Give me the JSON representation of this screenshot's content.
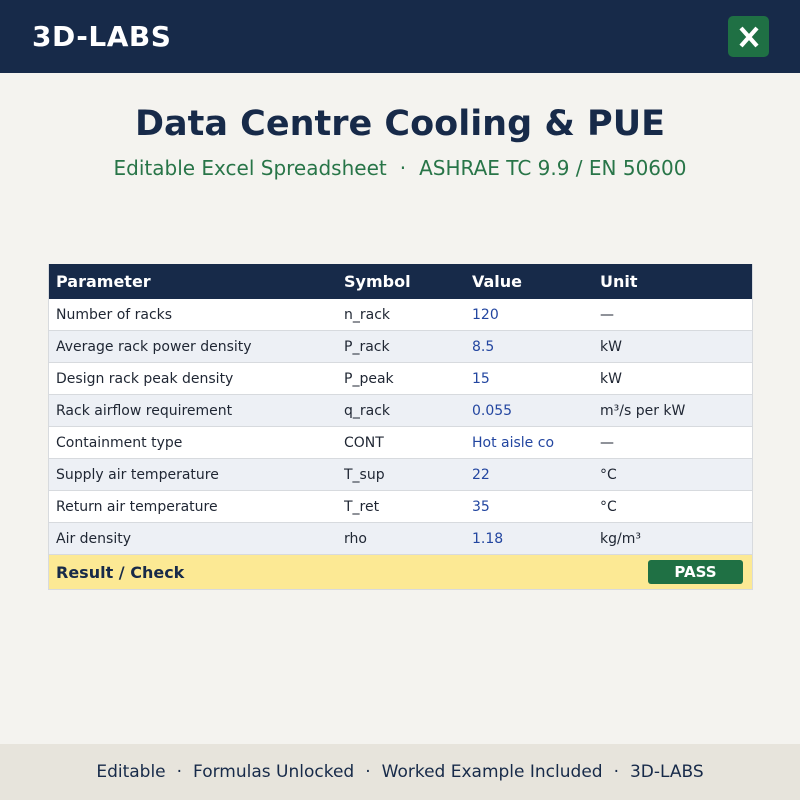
{
  "header": {
    "brand": "3D-LABS",
    "excel_icon_letter": "X",
    "excel_icon_color": "#1f7044",
    "bar_color": "#172a49"
  },
  "title": "Data Centre Cooling & PUE",
  "subtitle": {
    "left": "Editable Excel Spreadsheet",
    "separator": "·",
    "right": "ASHRAE TC 9.9 / EN 50600"
  },
  "table": {
    "columns": [
      "Parameter",
      "Symbol",
      "Value",
      "Unit"
    ],
    "rows": [
      {
        "parameter": "Number of racks",
        "symbol": "n_rack",
        "value": "120",
        "unit": "—"
      },
      {
        "parameter": "Average rack power density",
        "symbol": "P_rack",
        "value": "8.5",
        "unit": "kW"
      },
      {
        "parameter": "Design rack peak density",
        "symbol": "P_peak",
        "value": "15",
        "unit": "kW"
      },
      {
        "parameter": "Rack airflow requirement",
        "symbol": "q_rack",
        "value": "0.055",
        "unit": "m³/s per kW"
      },
      {
        "parameter": "Containment type",
        "symbol": "CONT",
        "value": "Hot aisle co",
        "unit": "—"
      },
      {
        "parameter": "Supply air temperature",
        "symbol": "T_sup",
        "value": "22",
        "unit": "°C"
      },
      {
        "parameter": "Return air temperature",
        "symbol": "T_ret",
        "value": "35",
        "unit": "°C"
      },
      {
        "parameter": "Air density",
        "symbol": "rho",
        "value": "1.18",
        "unit": "kg/m³"
      }
    ],
    "result_label": "Result / Check",
    "result_status": "PASS",
    "result_status_color": "#1f7044"
  },
  "footer": {
    "items": [
      "Editable",
      "Formulas Unlocked",
      "Worked Example Included",
      "3D-LABS"
    ],
    "separator": "·"
  }
}
